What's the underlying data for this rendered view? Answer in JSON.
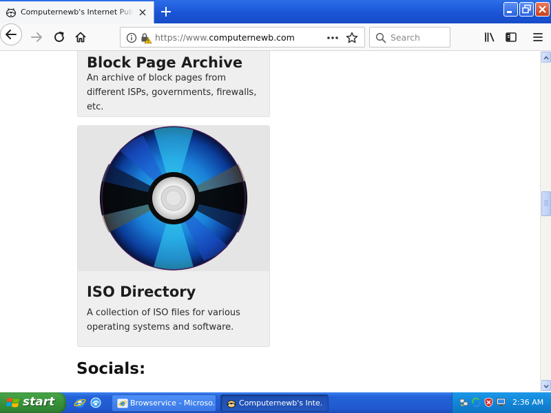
{
  "browser": {
    "tab": {
      "title": "Computernewb's Internet Pub Hub",
      "favicon": "raccoon-logo-icon"
    },
    "url": {
      "prefix": "https://www.",
      "domain": "computernewb.com"
    },
    "search": {
      "placeholder": "Search"
    }
  },
  "page": {
    "cards": [
      {
        "title": "Block Page Archive",
        "description": "An archive of block pages from different ISPs, governments, firewalls, etc."
      },
      {
        "title": "ISO Directory",
        "description": "A collection of ISO files for various operating systems and software.",
        "image": "cd-disc-icon"
      }
    ],
    "socials_heading": "Socials:"
  },
  "taskbar": {
    "start_label": "start",
    "tasks": [
      {
        "label": "Browservice - Microso...",
        "icon": "browservice-icon"
      },
      {
        "label": "Computernewb's Inte...",
        "icon": "raccoon-logo-icon"
      }
    ],
    "clock": "2:36 AM"
  },
  "colors": {
    "title_bar": "#1a55d6",
    "card_background": "#efefef",
    "start_button": "#37923a",
    "tray": "#1286d8"
  }
}
